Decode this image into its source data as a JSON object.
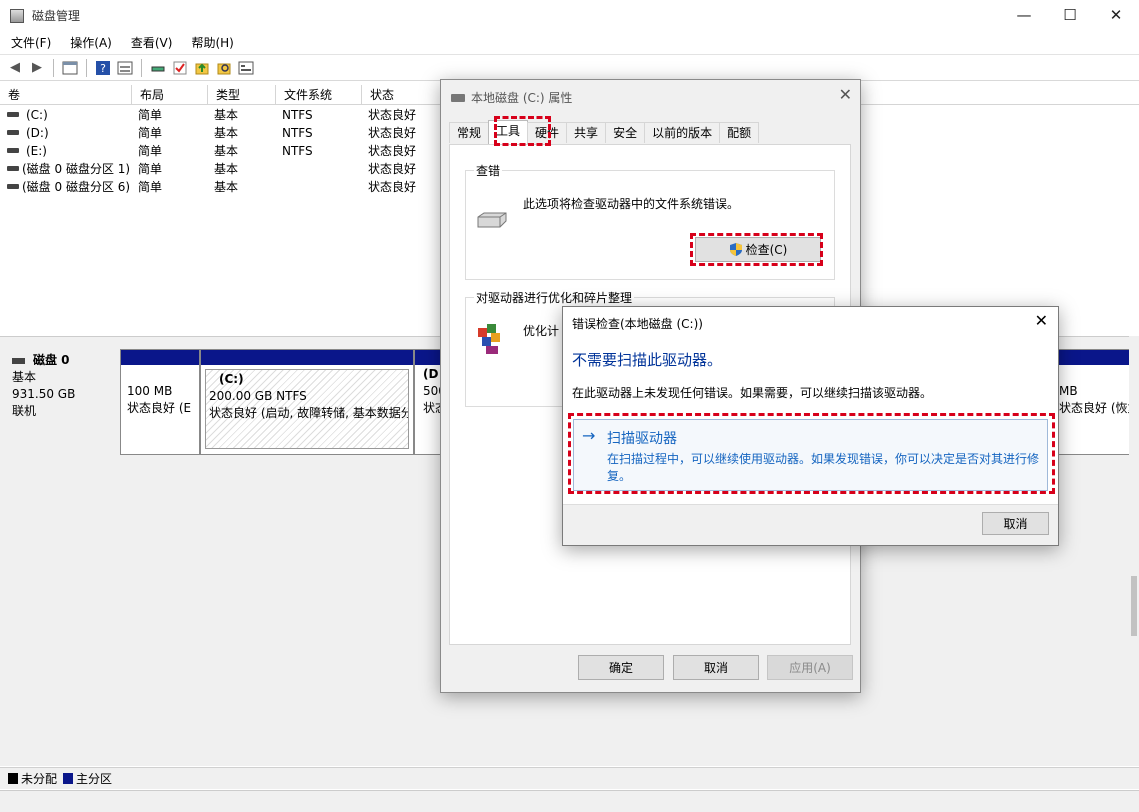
{
  "window": {
    "title": "磁盘管理",
    "minimize": "—",
    "maximize": "☐",
    "close": "✕"
  },
  "menu": [
    "文件(F)",
    "操作(A)",
    "查看(V)",
    "帮助(H)"
  ],
  "volume_columns": [
    "卷",
    "布局",
    "类型",
    "文件系统",
    "状态"
  ],
  "volumes": [
    {
      "name": "(C:)",
      "layout": "简单",
      "type": "基本",
      "fs": "NTFS",
      "status": "状态良好"
    },
    {
      "name": "(D:)",
      "layout": "简单",
      "type": "基本",
      "fs": "NTFS",
      "status": "状态良好"
    },
    {
      "name": "(E:)",
      "layout": "简单",
      "type": "基本",
      "fs": "NTFS",
      "status": "状态良好"
    },
    {
      "name": "(磁盘 0 磁盘分区 1)",
      "layout": "简单",
      "type": "基本",
      "fs": "",
      "status": "状态良好"
    },
    {
      "name": "(磁盘 0 磁盘分区 6)",
      "layout": "简单",
      "type": "基本",
      "fs": "",
      "status": "状态良好"
    }
  ],
  "disk": {
    "name": "磁盘 0",
    "type": "基本",
    "size": "931.50 GB",
    "state": "联机"
  },
  "partitions": [
    {
      "title": "",
      "size": "100 MB",
      "status": "状态良好 (E"
    },
    {
      "title": "(C:)",
      "size": "200.00 GB NTFS",
      "status": "状态良好 (启动, 故障转储, 基本数据分"
    },
    {
      "title": "(D",
      "size": "500",
      "status": "状态"
    },
    {
      "title": "",
      "size": "MB",
      "status": "状态良好 (恢复分"
    }
  ],
  "legend": [
    {
      "label": "未分配",
      "color": "#000000"
    },
    {
      "label": "主分区",
      "color": "#0a168a"
    }
  ],
  "properties": {
    "title": "本地磁盘 (C:) 属性",
    "close": "✕",
    "tabs": [
      "常规",
      "工具",
      "硬件",
      "共享",
      "安全",
      "以前的版本",
      "配额"
    ],
    "check_group": {
      "title": "查错",
      "text": "此选项将检查驱动器中的文件系统错误。",
      "button": "检查(C)"
    },
    "optimize_group": {
      "title": "对驱动器进行优化和碎片整理",
      "text": "优化计"
    },
    "ok": "确定",
    "cancel": "取消",
    "apply": "应用(A)"
  },
  "error_check": {
    "title": "错误检查(本地磁盘 (C:))",
    "close": "✕",
    "heading": "不需要扫描此驱动器。",
    "description": "在此驱动器上未发现任何错误。如果需要，可以继续扫描该驱动器。",
    "command_arrow": "→",
    "command_title": "扫描驱动器",
    "command_text": "在扫描过程中，可以继续使用驱动器。如果发现错误，你可以决定是否对其进行修复。",
    "cancel": "取消"
  },
  "colors": {
    "partition_bar": "#0a168a",
    "highlight": "#d7001a",
    "link_blue": "#1565c0"
  }
}
